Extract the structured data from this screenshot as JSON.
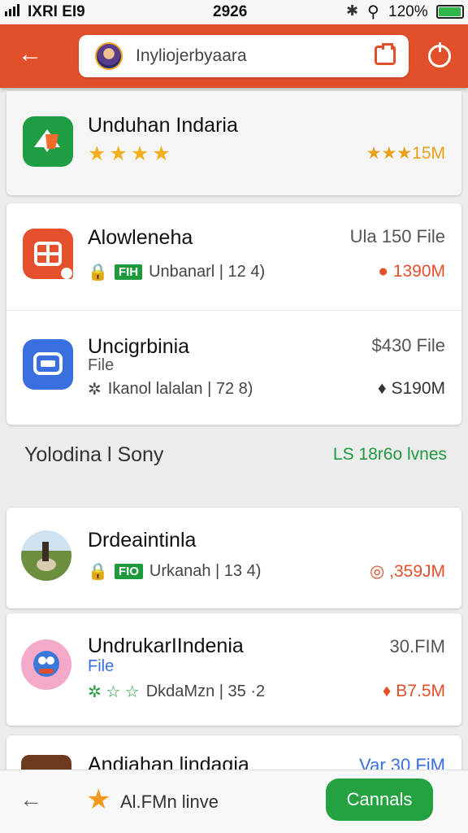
{
  "status_bar": {
    "carrier": "IXRI EI9",
    "time": "2926",
    "battery": "120%",
    "battery_fill": 0.95
  },
  "header": {
    "search_text": "Inyliojerbyaara"
  },
  "featured": {
    "title": "Unduhan Indaria",
    "stars": "★★★★",
    "right": "★★★15M"
  },
  "list_top": [
    {
      "title": "Alowleneha",
      "right_top": "Ula 150 File",
      "meta_icon": "🔒",
      "badge": "FIH",
      "meta_text": "Unbanarl | 12 4)",
      "right_bottom": "● 1390M",
      "right_bottom_color": "#e2502b"
    },
    {
      "title": "Uncigrbinia",
      "subtitle": "File",
      "right_top": "$430 File",
      "meta_icon": "✲",
      "meta_text": "Ikanol lalalan | 72 8)",
      "right_bottom": "♦ S190M",
      "right_bottom_color": "#333"
    }
  ],
  "section": {
    "label": "Yolodina l Sony",
    "count": "LS 18r6o lvnes"
  },
  "list_bottom": [
    {
      "title": "Drdeaintinla",
      "meta_icon": "🔒",
      "badge": "FIO",
      "meta_text": "Urkanah | 13 4)",
      "right_bottom": "◎ ,359JM",
      "right_bottom_color": "#e2502b"
    },
    {
      "title": "UndrukarIIndenia",
      "subtitle": "File",
      "right_top": "30.FIM",
      "meta_icon": "✲ ☆ ☆",
      "meta_text": "DkdaMzn | 35 ·2",
      "right_bottom": "♦ B7.5M",
      "right_bottom_color": "#e2502b"
    },
    {
      "title": "Andiahan lindagia",
      "right_top": "Var 30 FiM"
    }
  ],
  "bottom_bar": {
    "label": "Al.FMn linve",
    "cta": "Cannals"
  }
}
